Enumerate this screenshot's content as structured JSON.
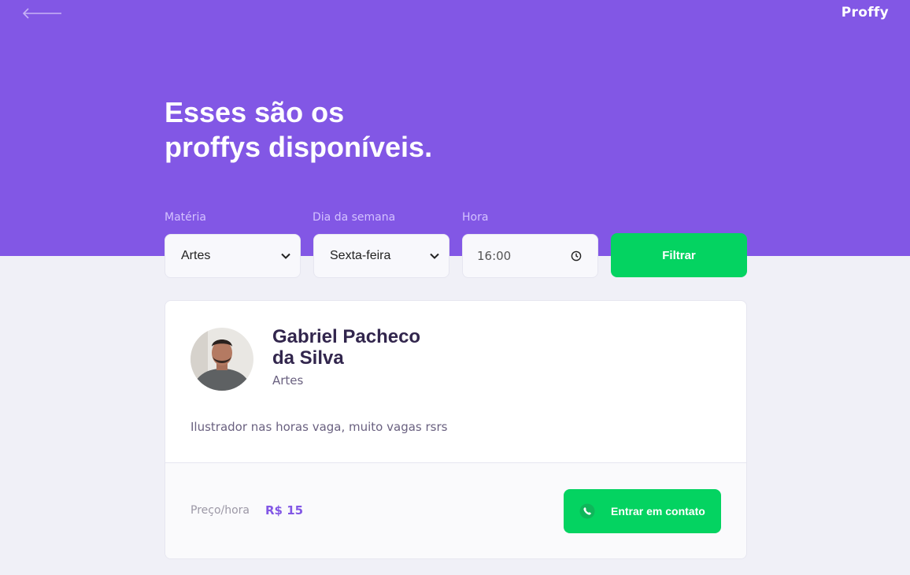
{
  "header": {
    "back_icon": "arrow-left-icon",
    "logo": "Proffy"
  },
  "page": {
    "title_line1": "Esses são os",
    "title_line2": "proffys disponíveis."
  },
  "filters": {
    "subject_label": "Matéria",
    "subject_value": "Artes",
    "weekday_label": "Dia da semana",
    "weekday_value": "Sexta-feira",
    "time_label": "Hora",
    "time_value": "16:00",
    "submit_label": "Filtrar"
  },
  "teacher": {
    "name_line1": "Gabriel Pacheco",
    "name_line2": "da Silva",
    "subject": "Artes",
    "bio": "Ilustrador nas horas vaga, muito vagas rsrs",
    "price_label": "Preço/hora",
    "price_value": "R$ 15",
    "contact_label": "Entrar em contato",
    "contact_icon": "whatsapp-icon"
  },
  "colors": {
    "primary": "#8257E5",
    "secondary": "#04D361",
    "background": "#F0F0F7"
  }
}
